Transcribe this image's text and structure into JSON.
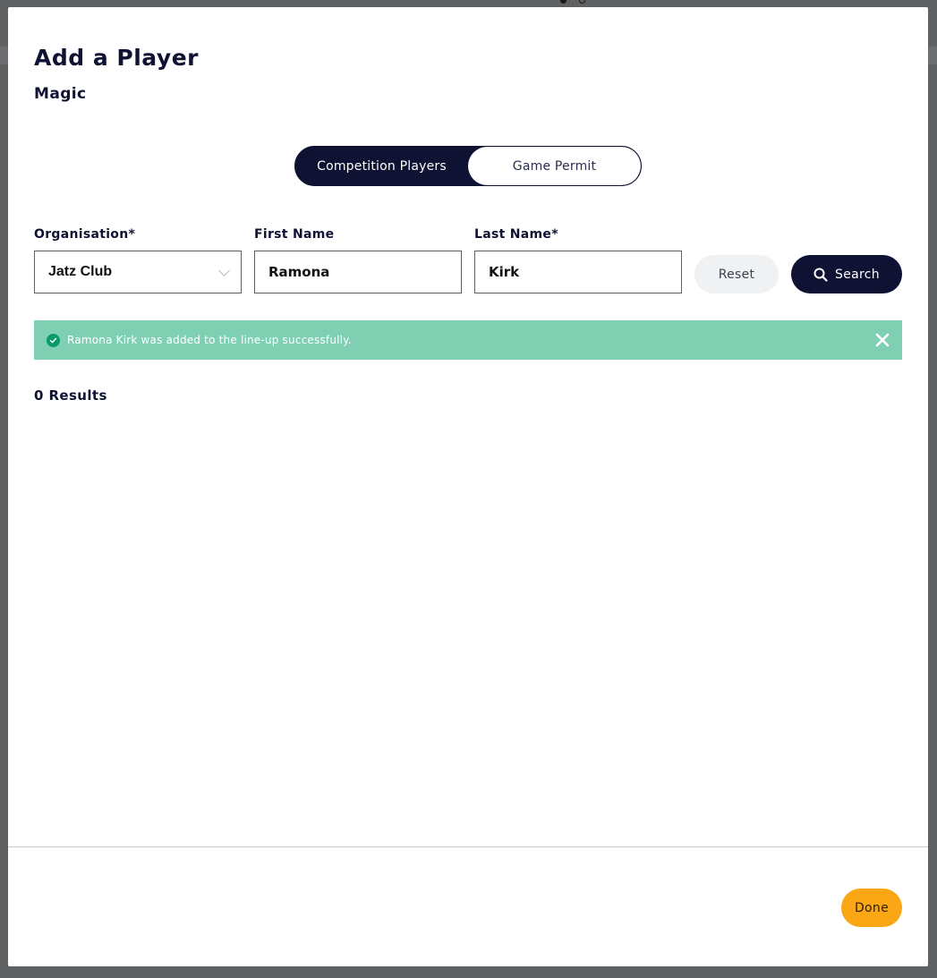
{
  "modal": {
    "title": "Add a Player",
    "subtitle": "Magic"
  },
  "toggle": {
    "options": [
      {
        "label": "Competition Players",
        "active": true
      },
      {
        "label": "Game Permit",
        "active": false
      }
    ]
  },
  "form": {
    "organisation": {
      "label": "Organisation*",
      "value": "Jatz Club"
    },
    "first_name": {
      "label": "First Name",
      "value": "Ramona"
    },
    "last_name": {
      "label": "Last Name*",
      "value": "Kirk"
    },
    "reset_label": "Reset",
    "search_label": "Search"
  },
  "alert": {
    "message": "Ramona Kirk was added to the line-up successfully.",
    "icon": "check-circle-icon",
    "color": "#7fd0b3"
  },
  "results": {
    "count_text": "0 Results"
  },
  "footer": {
    "done_label": "Done"
  },
  "colors": {
    "primary": "#0f1233",
    "accent": "#fba614",
    "success": "#7fd0b3"
  }
}
